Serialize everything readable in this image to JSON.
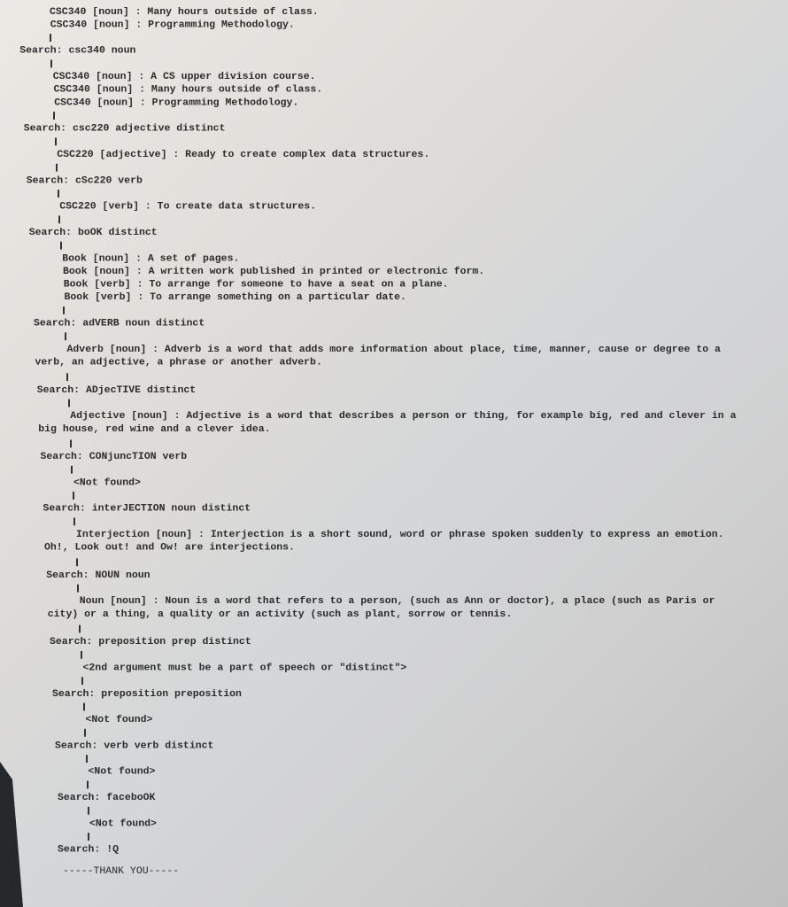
{
  "console": {
    "top_results": [
      "CSC340 [noun] : Many hours outside of class.",
      "CSC340 [noun] : Programming Methodology."
    ],
    "blocks": [
      {
        "search": "Search: csc340 noun",
        "results": [
          "CSC340 [noun] : A CS upper division course.",
          "CSC340 [noun] : Many hours outside of class.",
          "CSC340 [noun] : Programming Methodology."
        ]
      },
      {
        "search": "Search: csc220 adjective distinct",
        "results": [
          "CSC220 [adjective] : Ready to create complex data structures."
        ]
      },
      {
        "search": "Search: cSc220 verb",
        "results": [
          "CSC220 [verb] : To create data structures."
        ]
      },
      {
        "search": "Search: boOK distinct",
        "results": [
          "Book [noun] : A set of pages.",
          "Book [noun] : A written work published in printed or electronic form.",
          "Book [verb] : To arrange for someone to have a seat on a plane.",
          "Book [verb] : To arrange something on a particular date."
        ]
      },
      {
        "search": "Search: adVERB noun distinct",
        "results": [
          "Adverb [noun] : Adverb is a word that adds more information about place, time, manner, cause or degree to a verb, an adjective, a phrase or another adverb."
        ]
      },
      {
        "search": "Search: ADjecTIVE distinct",
        "results": [
          "Adjective [noun] : Adjective is a word that describes a person or thing, for example big, red and clever in a big house, red wine and a clever idea."
        ]
      },
      {
        "search": "Search: CONjuncTION verb",
        "results": [
          "<Not found>"
        ]
      },
      {
        "search": "Search: interJECTION noun distinct",
        "results": [
          "Interjection [noun] : Interjection is a short sound, word or phrase spoken suddenly to express an emotion. Oh!, Look out! and Ow! are interjections."
        ]
      },
      {
        "search": "Search: NOUN noun",
        "results": [
          "Noun [noun] : Noun is a word that refers to a person, (such as Ann or doctor), a place (such as Paris or city) or a thing, a quality or an activity (such as plant, sorrow or tennis."
        ]
      },
      {
        "search": "Search: preposition prep distinct",
        "results": [
          "<2nd argument must be a part of speech or \"distinct\">"
        ]
      },
      {
        "search": "Search: preposition preposition",
        "results": [
          "<Not found>"
        ]
      },
      {
        "search": "Search: verb verb distinct",
        "results": [
          "<Not found>"
        ]
      },
      {
        "search": "Search: faceboOK",
        "results": [
          "<Not found>"
        ]
      },
      {
        "search": "Search: !Q",
        "results": []
      }
    ],
    "footer": "-----THANK YOU-----"
  }
}
